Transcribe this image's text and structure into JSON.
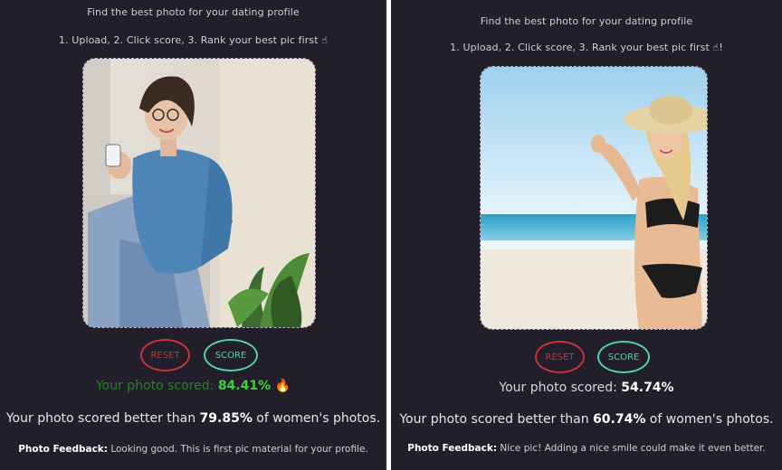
{
  "panels": [
    {
      "instruction_title": "Find the best photo for your dating profile",
      "instruction_steps": "1. Upload, 2. Click score, 3. Rank your best pic first ☝",
      "reset_label": "RESET",
      "score_label": "SCORE",
      "score_prefix": "Your photo scored: ",
      "score_value": "84.41%",
      "score_emoji": "🔥",
      "better_prefix": "Your photo scored better than ",
      "better_value": "79.85%",
      "better_suffix": " of women's photos.",
      "feedback_label": "Photo Feedback:",
      "feedback_text": "Looking good. This is first pic material for your profile."
    },
    {
      "instruction_title": "Find the best photo for your dating profile",
      "instruction_steps": "1. Upload, 2. Click score, 3. Rank your best pic first ☝!",
      "reset_label": "RESET",
      "score_label": "SCORE",
      "score_prefix": "Your photo scored: ",
      "score_value": "54.74%",
      "better_prefix": "Your photo scored better than ",
      "better_value": "60.74%",
      "better_suffix": " of women's photos.",
      "feedback_label": "Photo Feedback:",
      "feedback_text": "Nice pic! Adding a nice smile could make it even better."
    }
  ],
  "colors": {
    "panel_bg": "#221f2a",
    "reset_accent": "#c7333c",
    "score_accent": "#52cfb7",
    "high_score_green": "#3fcf3c"
  },
  "icons": {
    "fire": "fire-icon",
    "pointing": "pointing-up-emoji"
  }
}
